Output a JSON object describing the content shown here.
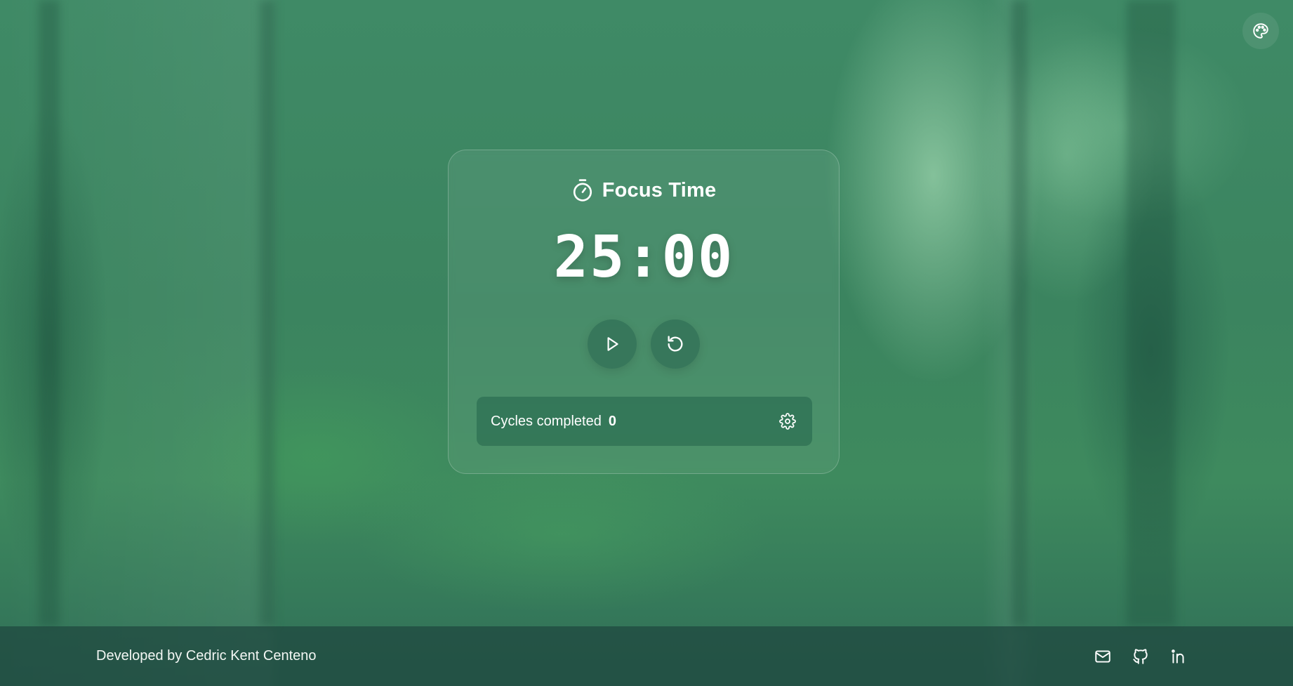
{
  "theme": {
    "accent": "#3f8a66",
    "text_color": "#ffffff"
  },
  "top_right": {
    "icon": "palette-icon"
  },
  "timer_card": {
    "icon": "stopwatch-icon",
    "title": "Focus Time",
    "time_display": "25:00",
    "controls": [
      {
        "name": "start",
        "icon": "play-icon"
      },
      {
        "name": "reset",
        "icon": "reset-icon"
      }
    ],
    "cycles": {
      "label": "Cycles completed",
      "count": "0",
      "settings_icon": "gear-icon"
    }
  },
  "footer": {
    "credit": "Developed by Cedric Kent Centeno",
    "links": [
      {
        "name": "email",
        "icon": "mail-icon"
      },
      {
        "name": "github",
        "icon": "github-icon"
      },
      {
        "name": "linkedin",
        "icon": "linkedin-icon"
      }
    ]
  }
}
